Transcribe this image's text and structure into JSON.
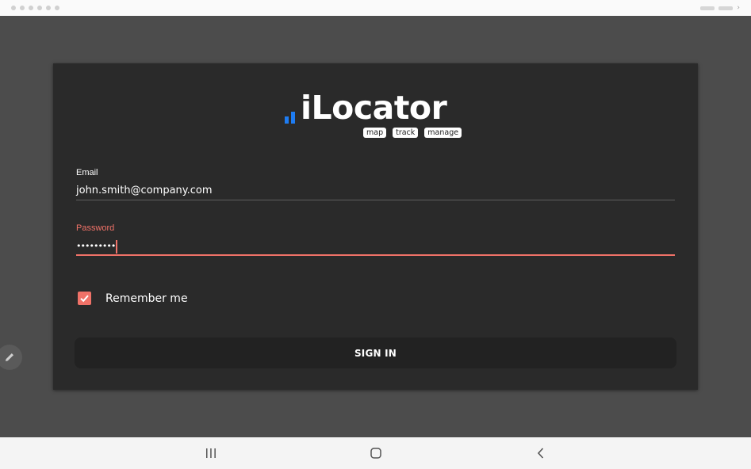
{
  "app": {
    "name": "iLocator",
    "tags": [
      "map",
      "track",
      "manage"
    ],
    "brand_color": "#1e7cf2",
    "accent_color": "#f07268"
  },
  "form": {
    "email": {
      "label": "Email",
      "value": "john.smith@company.com"
    },
    "password": {
      "label": "Password",
      "masked_value": "•••••••••"
    },
    "remember": {
      "label": "Remember me",
      "checked": true
    },
    "submit_label": "SIGN IN"
  },
  "floating_button": {
    "icon": "pencil-icon"
  },
  "navigation_bar": {
    "recents": {
      "icon": "recent-apps-icon"
    },
    "home": {
      "icon": "home-icon"
    },
    "back": {
      "icon": "back-icon"
    }
  }
}
